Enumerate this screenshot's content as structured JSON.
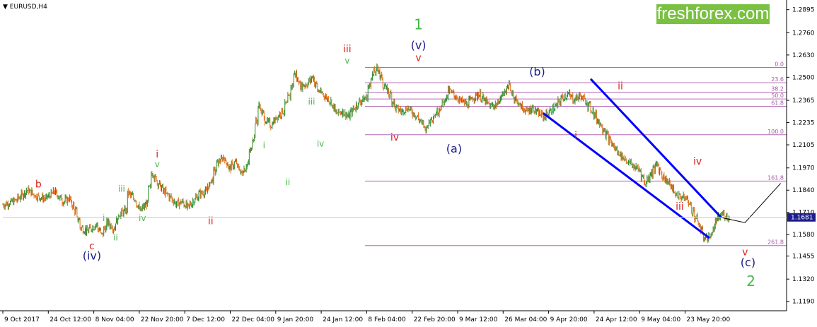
{
  "header": {
    "symbol_label": "EURUSD,H4",
    "symbol_arrow": "▼"
  },
  "brand": {
    "logo_text": "freshforex.com"
  },
  "colors": {
    "background": "#ffffff",
    "up_candle": "#2e8b2e",
    "down_candle": "#e0701c",
    "fib_lines": "#b46cb4",
    "channel": "#0000ff",
    "wave_red": "#e02020",
    "wave_green": "#49b649",
    "wave_navy": "#1c1c8a",
    "current_price_bg": "#1c1c8a",
    "brand_bg": "#7ac142"
  },
  "chart_data": {
    "type": "candlestick",
    "symbol": "EURUSD",
    "timeframe": "H4",
    "ylim": [
      1.1135,
      1.2935
    ],
    "x_tick_labels": [
      "9 Oct 2017",
      "24 Oct 12:00",
      "8 Nov 04:00",
      "22 Nov 20:00",
      "7 Dec 12:00",
      "22 Dec 04:00",
      "9 Jan 20:00",
      "24 Jan 12:00",
      "8 Feb 04:00",
      "22 Feb 20:00",
      "9 Mar 12:00",
      "26 Mar 04:00",
      "9 Apr 20:00",
      "24 Apr 12:00",
      "9 May 04:00",
      "23 May 20:00"
    ],
    "y_tick_labels": [
      "1.2895",
      "1.2760",
      "1.2630",
      "1.2500",
      "1.2365",
      "1.2235",
      "1.2105",
      "1.1970",
      "1.1840",
      "1.1710",
      "1.1580",
      "1.1455",
      "1.1320",
      "1.1190"
    ],
    "current_price": "1.1681",
    "price_path": [
      [
        0,
        1.1755
      ],
      [
        4,
        1.178
      ],
      [
        8,
        1.184
      ],
      [
        11,
        1.1805
      ],
      [
        14,
        1.179
      ],
      [
        17,
        1.183
      ],
      [
        20,
        1.1775
      ],
      [
        22,
        1.179
      ],
      [
        24,
        1.172
      ],
      [
        26,
        1.162
      ],
      [
        28,
        1.16
      ],
      [
        30,
        1.1625
      ],
      [
        31,
        1.164
      ],
      [
        33,
        1.158
      ],
      [
        35,
        1.165
      ],
      [
        37,
        1.162
      ],
      [
        39,
        1.17
      ],
      [
        41,
        1.172
      ],
      [
        42,
        1.182
      ],
      [
        44,
        1.179
      ],
      [
        46,
        1.172
      ],
      [
        48,
        1.176
      ],
      [
        50,
        1.194
      ],
      [
        52,
        1.188
      ],
      [
        54,
        1.183
      ],
      [
        56,
        1.18
      ],
      [
        58,
        1.176
      ],
      [
        60,
        1.177
      ],
      [
        62,
        1.174
      ],
      [
        64,
        1.178
      ],
      [
        66,
        1.182
      ],
      [
        68,
        1.183
      ],
      [
        70,
        1.19
      ],
      [
        72,
        1.2
      ],
      [
        74,
        1.203
      ],
      [
        76,
        1.197
      ],
      [
        78,
        1.2
      ],
      [
        80,
        1.194
      ],
      [
        82,
        1.199
      ],
      [
        84,
        1.215
      ],
      [
        86,
        1.233
      ],
      [
        88,
        1.225
      ],
      [
        90,
        1.222
      ],
      [
        92,
        1.227
      ],
      [
        94,
        1.23
      ],
      [
        96,
        1.238
      ],
      [
        98,
        1.252
      ],
      [
        100,
        1.245
      ],
      [
        102,
        1.246
      ],
      [
        104,
        1.25
      ],
      [
        106,
        1.242
      ],
      [
        108,
        1.239
      ],
      [
        110,
        1.236
      ],
      [
        112,
        1.229
      ],
      [
        114,
        1.23
      ],
      [
        116,
        1.227
      ],
      [
        118,
        1.232
      ],
      [
        120,
        1.236
      ],
      [
        122,
        1.238
      ],
      [
        124,
        1.251
      ],
      [
        126,
        1.255
      ],
      [
        128,
        1.245
      ],
      [
        130,
        1.24
      ],
      [
        132,
        1.232
      ],
      [
        134,
        1.23
      ],
      [
        136,
        1.232
      ],
      [
        138,
        1.229
      ],
      [
        140,
        1.225
      ],
      [
        142,
        1.22
      ],
      [
        144,
        1.226
      ],
      [
        146,
        1.23
      ],
      [
        148,
        1.235
      ],
      [
        150,
        1.242
      ],
      [
        152,
        1.239
      ],
      [
        154,
        1.236
      ],
      [
        156,
        1.234
      ],
      [
        158,
        1.238
      ],
      [
        160,
        1.24
      ],
      [
        162,
        1.236
      ],
      [
        164,
        1.233
      ],
      [
        166,
        1.234
      ],
      [
        168,
        1.24
      ],
      [
        170,
        1.245
      ],
      [
        172,
        1.238
      ],
      [
        174,
        1.233
      ],
      [
        176,
        1.23
      ],
      [
        178,
        1.232
      ],
      [
        180,
        1.229
      ],
      [
        182,
        1.227
      ],
      [
        184,
        1.23
      ],
      [
        186,
        1.233
      ],
      [
        188,
        1.238
      ],
      [
        190,
        1.24
      ],
      [
        192,
        1.237
      ],
      [
        194,
        1.239
      ],
      [
        196,
        1.236
      ],
      [
        198,
        1.231
      ],
      [
        200,
        1.225
      ],
      [
        202,
        1.22
      ],
      [
        204,
        1.213
      ],
      [
        206,
        1.208
      ],
      [
        208,
        1.204
      ],
      [
        210,
        1.201
      ],
      [
        212,
        1.198
      ],
      [
        214,
        1.196
      ],
      [
        216,
        1.188
      ],
      [
        218,
        1.194
      ],
      [
        220,
        1.199
      ],
      [
        222,
        1.192
      ],
      [
        224,
        1.188
      ],
      [
        226,
        1.182
      ],
      [
        228,
        1.18
      ],
      [
        230,
        1.179
      ],
      [
        232,
        1.172
      ],
      [
        234,
        1.164
      ],
      [
        236,
        1.156
      ],
      [
        238,
        1.157
      ],
      [
        240,
        1.166
      ],
      [
        242,
        1.17
      ],
      [
        244,
        1.1681
      ]
    ],
    "fib_levels": [
      {
        "label": "0.0",
        "price": 1.2557
      },
      {
        "label": "23.6",
        "price": 1.2468
      },
      {
        "label": "38.2",
        "price": 1.2413
      },
      {
        "label": "50.0",
        "price": 1.2373
      },
      {
        "label": "61.8",
        "price": 1.233
      },
      {
        "label": "100.0",
        "price": 1.2164
      },
      {
        "label": "161.8",
        "price": 1.1893
      },
      {
        "label": "261.8",
        "price": 1.1516
      }
    ],
    "channel_lines": [
      {
        "from": [
          198,
          1.249
        ],
        "to": [
          242,
          1.168
        ]
      },
      {
        "from": [
          182,
          1.229
        ],
        "to": [
          238,
          1.156
        ]
      }
    ],
    "forecast_path": [
      [
        242,
        1.168
      ],
      [
        250,
        1.165
      ],
      [
        262,
        1.188
      ]
    ],
    "wave_labels": [
      {
        "text": "b",
        "color": "red",
        "x": 12,
        "price": 1.1855,
        "size": 14
      },
      {
        "text": "c",
        "color": "red",
        "x": 30,
        "price": 1.1495,
        "size": 14
      },
      {
        "text": "(iv)",
        "color": "navy",
        "x": 30,
        "price": 1.1435,
        "size": 16
      },
      {
        "text": "i",
        "color": "green",
        "x": 34,
        "price": 1.166,
        "size": 12
      },
      {
        "text": "ii",
        "color": "green",
        "x": 38,
        "price": 1.1545,
        "size": 12
      },
      {
        "text": "iii",
        "color": "green",
        "x": 40,
        "price": 1.183,
        "size": 12
      },
      {
        "text": "iv",
        "color": "green",
        "x": 47,
        "price": 1.166,
        "size": 12
      },
      {
        "text": "i",
        "color": "red",
        "x": 52,
        "price": 1.203,
        "size": 14
      },
      {
        "text": "v",
        "color": "green",
        "x": 52,
        "price": 1.1975,
        "size": 12
      },
      {
        "text": "ii",
        "color": "red",
        "x": 70,
        "price": 1.164,
        "size": 14
      },
      {
        "text": "i",
        "color": "green",
        "x": 88,
        "price": 1.2085,
        "size": 12
      },
      {
        "text": "ii",
        "color": "green",
        "x": 96,
        "price": 1.187,
        "size": 12
      },
      {
        "text": "iii",
        "color": "green",
        "x": 104,
        "price": 1.234,
        "size": 12
      },
      {
        "text": "iv",
        "color": "green",
        "x": 107,
        "price": 1.2095,
        "size": 12
      },
      {
        "text": "iii",
        "color": "red",
        "x": 116,
        "price": 1.2645,
        "size": 14
      },
      {
        "text": "v",
        "color": "green",
        "x": 116,
        "price": 1.258,
        "size": 12
      },
      {
        "text": "1",
        "color": "green",
        "x": 140,
        "price": 1.278,
        "size": 20
      },
      {
        "text": "(v)",
        "color": "navy",
        "x": 140,
        "price": 1.2665,
        "size": 16
      },
      {
        "text": "v",
        "color": "red",
        "x": 140,
        "price": 1.2595,
        "size": 14
      },
      {
        "text": "iv",
        "color": "red",
        "x": 132,
        "price": 1.213,
        "size": 14
      },
      {
        "text": "(a)",
        "color": "navy",
        "x": 152,
        "price": 1.206,
        "size": 16
      },
      {
        "text": "(b)",
        "color": "navy",
        "x": 180,
        "price": 1.251,
        "size": 16
      },
      {
        "text": "i",
        "color": "red",
        "x": 193,
        "price": 1.214,
        "size": 14
      },
      {
        "text": "ii",
        "color": "red",
        "x": 208,
        "price": 1.243,
        "size": 14
      },
      {
        "text": "iv",
        "color": "red",
        "x": 234,
        "price": 1.199,
        "size": 14
      },
      {
        "text": "iii",
        "color": "red",
        "x": 228,
        "price": 1.1725,
        "size": 14
      },
      {
        "text": "v",
        "color": "red",
        "x": 250,
        "price": 1.146,
        "size": 14
      },
      {
        "text": "(c)",
        "color": "navy",
        "x": 251,
        "price": 1.1395,
        "size": 16
      },
      {
        "text": "2",
        "color": "green",
        "x": 252,
        "price": 1.128,
        "size": 20
      }
    ]
  }
}
